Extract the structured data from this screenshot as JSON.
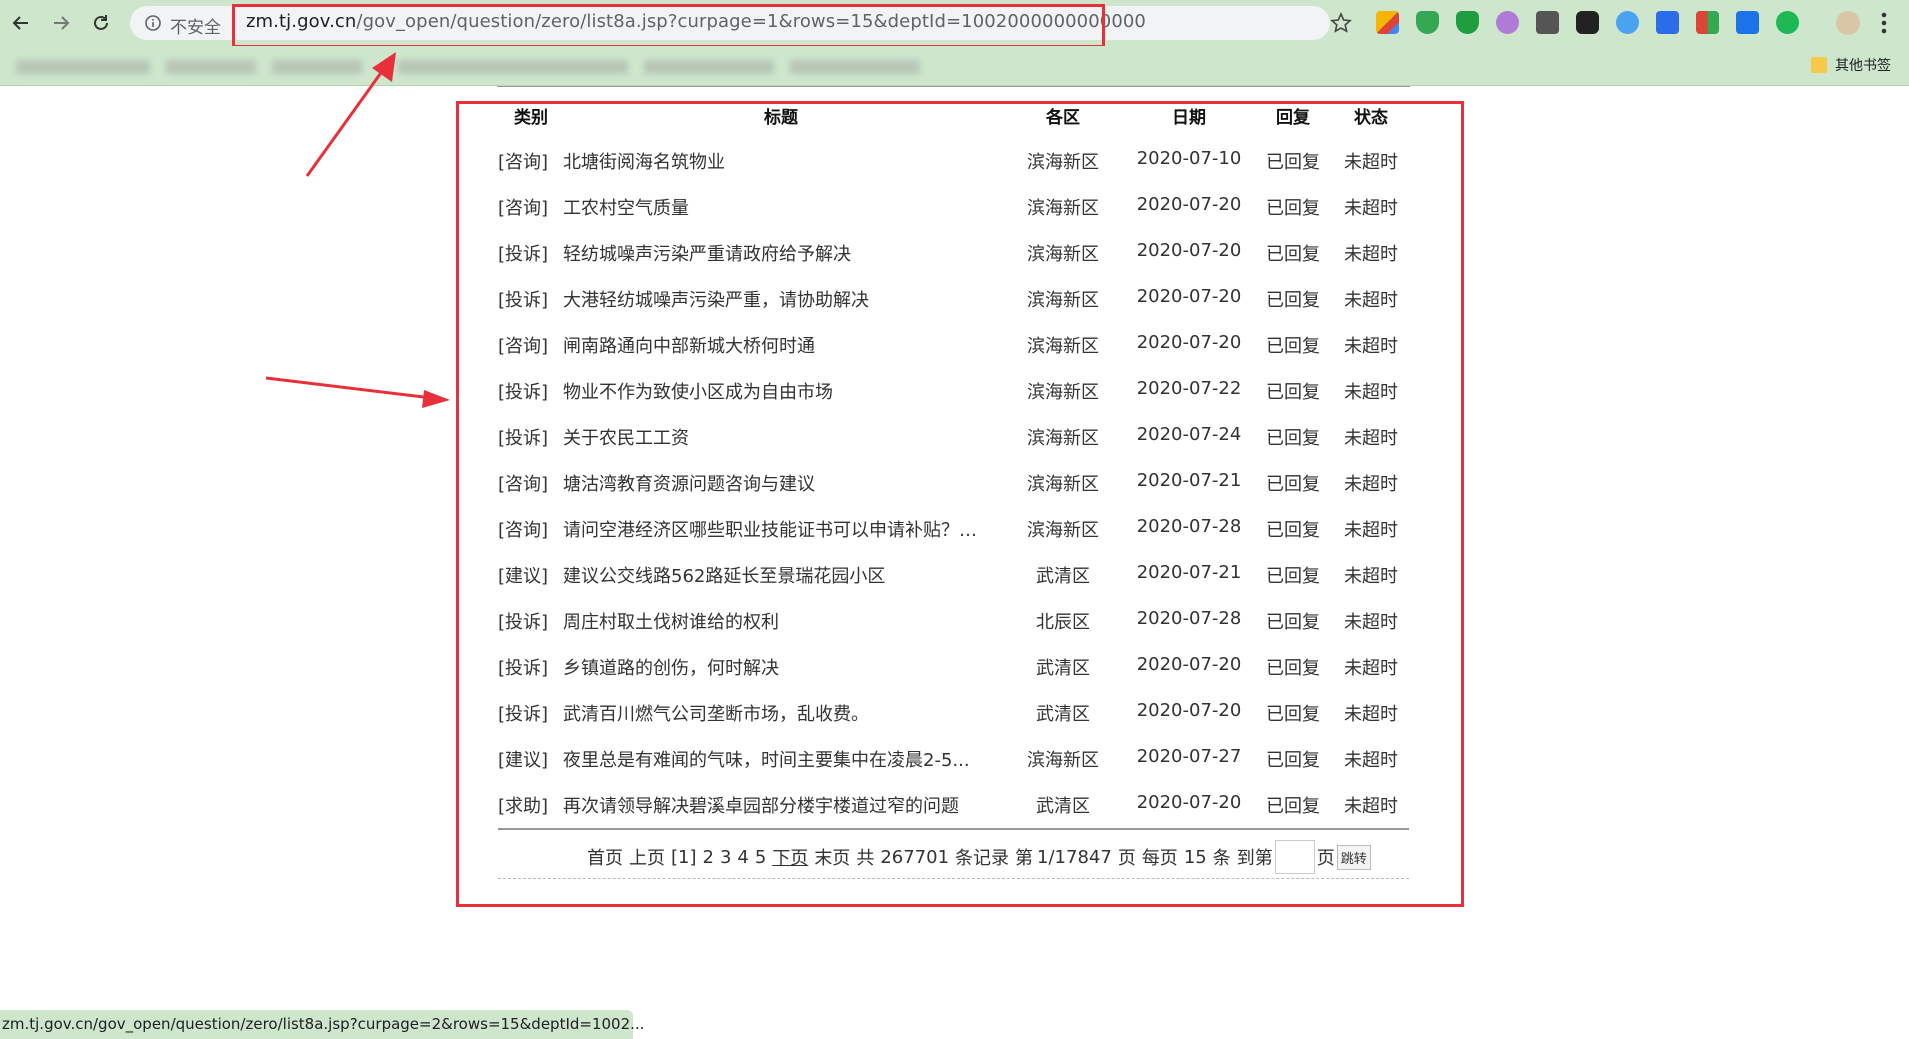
{
  "browser": {
    "insecure_label": "不安全",
    "url_host": "zm.tj.gov.cn",
    "url_rest": "/gov_open/question/zero/list8a.jsp?curpage=1&rows=15&deptId=1002000000000000",
    "other_bookmarks": "其他书签",
    "status_url": "zm.tj.gov.cn/gov_open/question/zero/list8a.jsp?curpage=2&rows=15&deptId=1002..."
  },
  "table": {
    "headers": [
      "类别",
      "标题",
      "各区",
      "日期",
      "回复",
      "状态"
    ],
    "rows": [
      {
        "cat": "[咨询]",
        "title": "北塘街阅海名筑物业",
        "district": "滨海新区",
        "date": "2020-07-10",
        "reply": "已回复",
        "status": "未超时"
      },
      {
        "cat": "[咨询]",
        "title": "工农村空气质量",
        "district": "滨海新区",
        "date": "2020-07-20",
        "reply": "已回复",
        "status": "未超时"
      },
      {
        "cat": "[投诉]",
        "title": "轻纺城噪声污染严重请政府给予解决",
        "district": "滨海新区",
        "date": "2020-07-20",
        "reply": "已回复",
        "status": "未超时"
      },
      {
        "cat": "[投诉]",
        "title": "大港轻纺城噪声污染严重，请协助解决",
        "district": "滨海新区",
        "date": "2020-07-20",
        "reply": "已回复",
        "status": "未超时"
      },
      {
        "cat": "[咨询]",
        "title": "闸南路通向中部新城大桥何时通",
        "district": "滨海新区",
        "date": "2020-07-20",
        "reply": "已回复",
        "status": "未超时"
      },
      {
        "cat": "[投诉]",
        "title": "物业不作为致使小区成为自由市场",
        "district": "滨海新区",
        "date": "2020-07-22",
        "reply": "已回复",
        "status": "未超时"
      },
      {
        "cat": "[投诉]",
        "title": "关于农民工工资",
        "district": "滨海新区",
        "date": "2020-07-24",
        "reply": "已回复",
        "status": "未超时"
      },
      {
        "cat": "[咨询]",
        "title": "塘沽湾教育资源问题咨询与建议",
        "district": "滨海新区",
        "date": "2020-07-21",
        "reply": "已回复",
        "status": "未超时"
      },
      {
        "cat": "[咨询]",
        "title": "请问空港经济区哪些职业技能证书可以申请补贴？在...",
        "district": "滨海新区",
        "date": "2020-07-28",
        "reply": "已回复",
        "status": "未超时"
      },
      {
        "cat": "[建议]",
        "title": "建议公交线路562路延长至景瑞花园小区",
        "district": "武清区",
        "date": "2020-07-21",
        "reply": "已回复",
        "status": "未超时"
      },
      {
        "cat": "[投诉]",
        "title": "周庄村取土伐树谁给的权利",
        "district": "北辰区",
        "date": "2020-07-28",
        "reply": "已回复",
        "status": "未超时"
      },
      {
        "cat": "[投诉]",
        "title": "乡镇道路的创伤，何时解决",
        "district": "武清区",
        "date": "2020-07-20",
        "reply": "已回复",
        "status": "未超时"
      },
      {
        "cat": "[投诉]",
        "title": "武清百川燃气公司垄断市场，乱收费。",
        "district": "武清区",
        "date": "2020-07-20",
        "reply": "已回复",
        "status": "未超时"
      },
      {
        "cat": "[建议]",
        "title": "夜里总是有难闻的气味，时间主要集中在凌晨2-5...",
        "district": "滨海新区",
        "date": "2020-07-27",
        "reply": "已回复",
        "status": "未超时"
      },
      {
        "cat": "[求助]",
        "title": "再次请领导解决碧溪卓园部分楼宇楼道过窄的问题",
        "district": "武清区",
        "date": "2020-07-20",
        "reply": "已回复",
        "status": "未超时"
      }
    ]
  },
  "pager": {
    "first": "首页",
    "prev": "上页",
    "current": "[1]",
    "pages": [
      "2",
      "3",
      "4",
      "5"
    ],
    "next": "下页",
    "last": "末页",
    "total_prefix": "共",
    "total": "267701",
    "total_suffix": "条记录",
    "page_prefix": "第",
    "page_info": "1/17847",
    "page_suffix": "页",
    "per_prefix": "每页",
    "per_page": "15",
    "per_suffix": "条",
    "goto_prefix": "到第",
    "goto_suffix": "页",
    "goto_button": "跳转"
  },
  "colors": {
    "highlight": "#e8303a",
    "chrome_bg": "#cde6cc"
  }
}
